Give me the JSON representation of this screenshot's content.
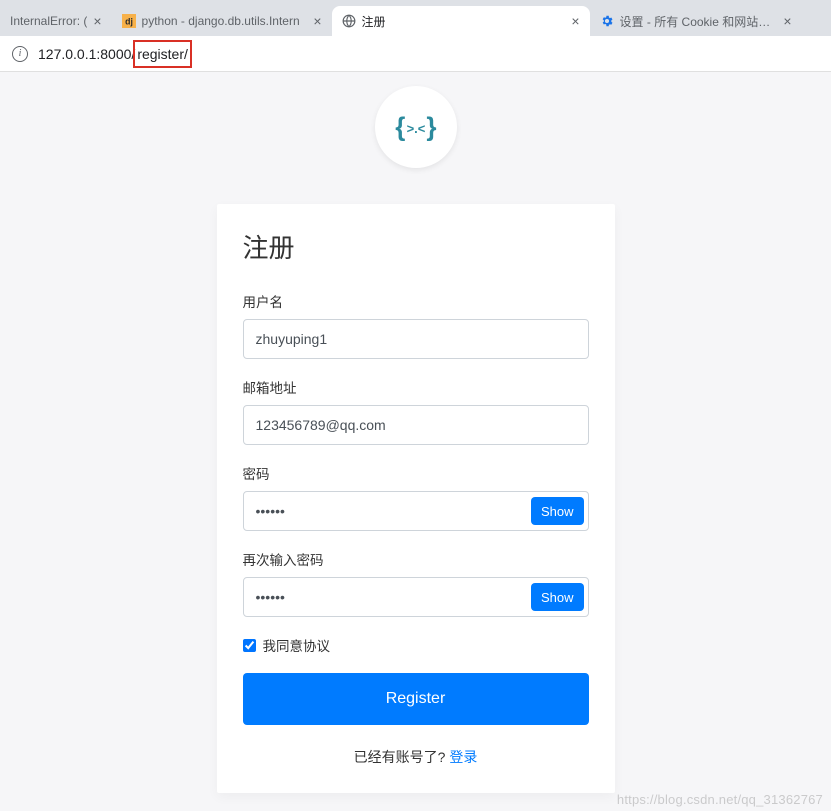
{
  "browser": {
    "tabs": [
      {
        "title": "InternalError: (",
        "favicon": "blank",
        "active": false
      },
      {
        "title": "python - django.db.utils.Intern",
        "favicon": "dj",
        "active": false
      },
      {
        "title": "注册",
        "favicon": "globe",
        "active": true
      },
      {
        "title": "设置 - 所有 Cookie 和网站数据",
        "favicon": "gear",
        "active": false
      }
    ],
    "url_prefix": "127.0.0.1:8000/",
    "url_highlight": "register/"
  },
  "avatar_face": ">.<",
  "form": {
    "title": "注册",
    "username_label": "用户名",
    "username_value": "zhuyuping1",
    "email_label": "邮箱地址",
    "email_value": "123456789@qq.com",
    "password_label": "密码",
    "password_value": "••••••",
    "password2_label": "再次输入密码",
    "password2_value": "••••••",
    "show_label": "Show",
    "agree_label": "我同意协议",
    "agree_checked": true,
    "submit_label": "Register",
    "already_text": "已经有账号了?",
    "login_link": "登录"
  },
  "watermark": "https://blog.csdn.net/qq_31362767"
}
